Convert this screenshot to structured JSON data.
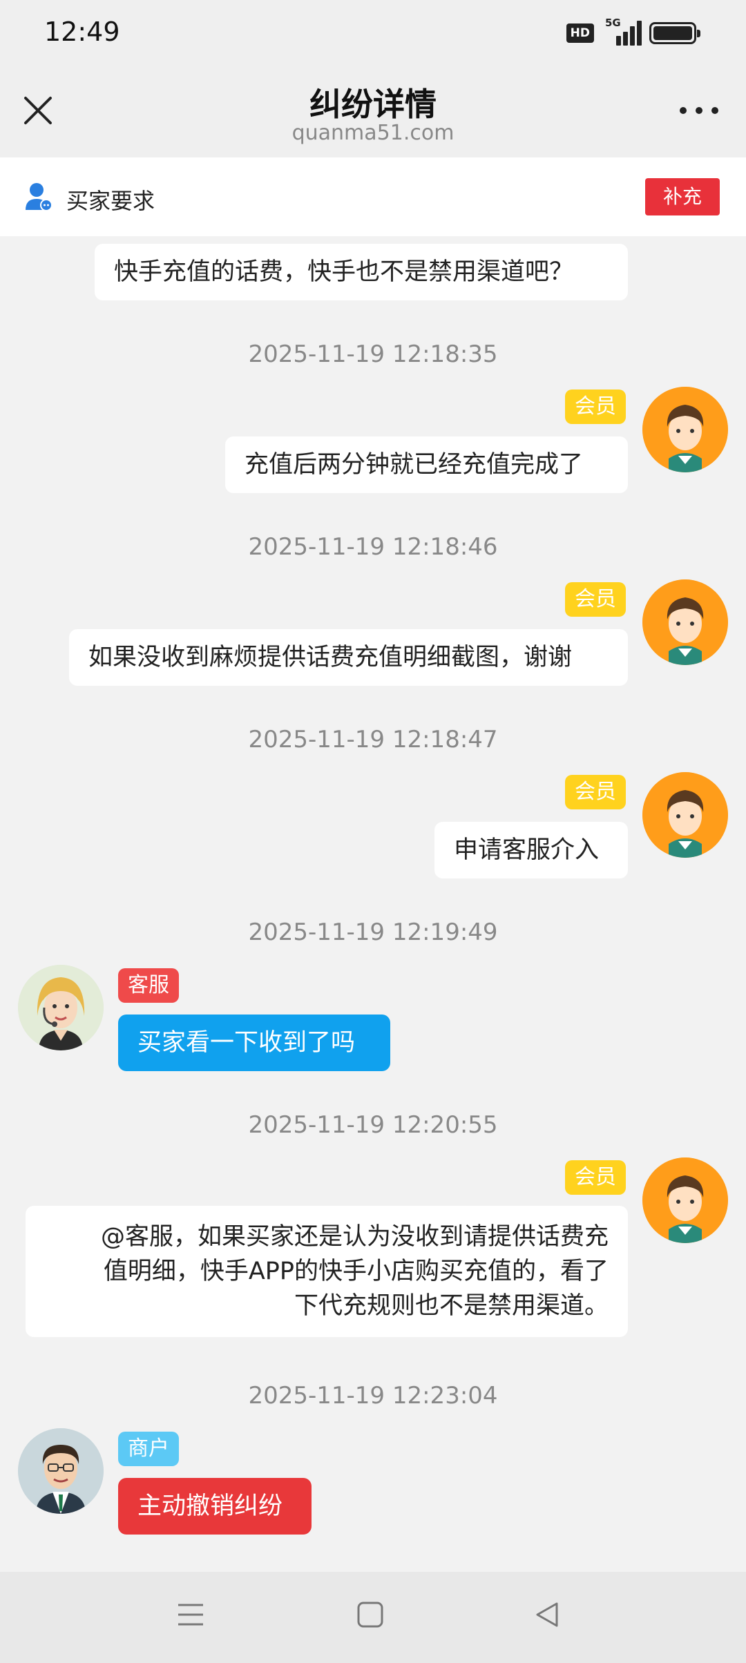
{
  "status_bar": {
    "time": "12:49",
    "hd_label": "HD",
    "network_label": "5G",
    "battery_level": 1.0
  },
  "header": {
    "title": "纠纷详情",
    "subtitle": "quanma51.com",
    "close_icon": "close-icon",
    "more_icon": "more-icon"
  },
  "request_bar": {
    "label": "买家要求",
    "button_label": "补充"
  },
  "messages": [
    {
      "sender": "member",
      "text": "快手充值的话费，快手也不是禁用渠道吧？"
    },
    {
      "timestamp": "2025-11-19 12:18:35",
      "sender": "member",
      "tag": "会员",
      "text": "充值后两分钟就已经充值完成了"
    },
    {
      "timestamp": "2025-11-19 12:18:46",
      "sender": "member",
      "tag": "会员",
      "text": "如果没收到麻烦提供话费充值明细截图，谢谢"
    },
    {
      "timestamp": "2025-11-19 12:18:47",
      "sender": "member",
      "tag": "会员",
      "text": "申请客服介入"
    },
    {
      "timestamp": "2025-11-19 12:19:49",
      "sender": "service",
      "tag": "客服",
      "text": "买家看一下收到了吗"
    },
    {
      "timestamp": "2025-11-19 12:20:55",
      "sender": "member",
      "tag": "会员",
      "text_lines": [
        "@客服，如果买家还是认为没收到请提供话费充",
        "值明细，快手APP的快手小店购买充值的，看了",
        "下代充规则也不是禁用渠道。"
      ]
    },
    {
      "timestamp": "2025-11-19 12:23:04",
      "sender": "merchant",
      "tag": "商户",
      "text": "主动撤销纠纷"
    }
  ],
  "colors": {
    "member_tag": "#ffd21e",
    "service_tag": "#ef4a4a",
    "merchant_tag": "#5cc9f5",
    "service_bubble": "#10a1ee",
    "merchant_bubble": "#e8383a",
    "request_button": "#e8313a"
  },
  "system_nav": {
    "menu_icon": "menu-icon",
    "home_icon": "home-icon",
    "back_icon": "back-icon"
  }
}
